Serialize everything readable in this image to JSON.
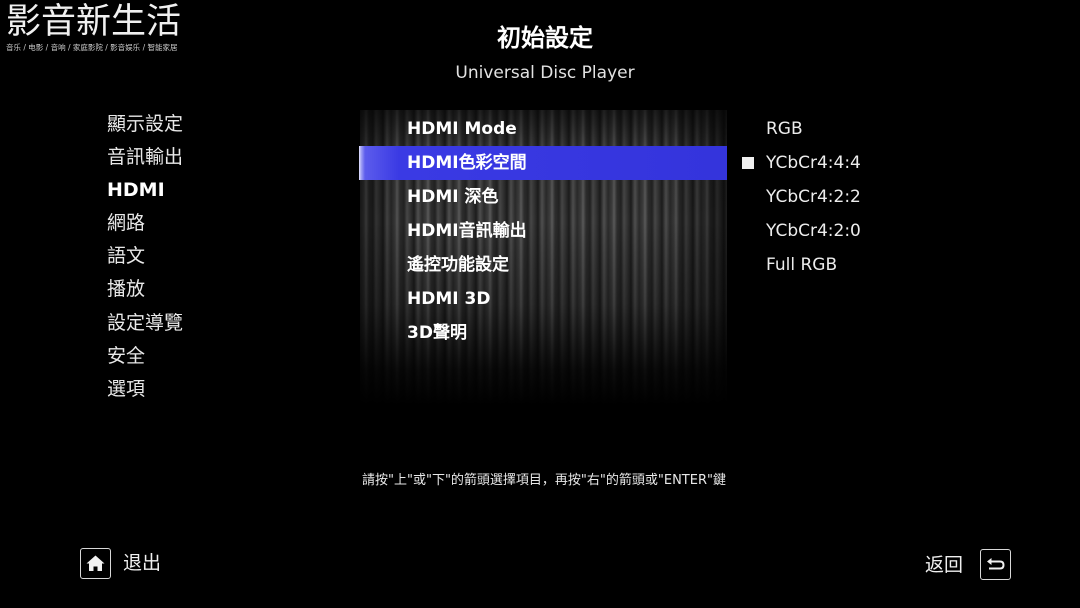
{
  "watermark": {
    "title": "影音新生活",
    "subtitle": "音乐 / 电影 / 音响 / 家庭影院 / 影音娱乐 / 智能家居"
  },
  "header": {
    "title": "初始設定",
    "subtitle": "Universal Disc Player"
  },
  "categories": [
    {
      "label": "顯示設定",
      "selected": false
    },
    {
      "label": "音訊輸出",
      "selected": false
    },
    {
      "label": "HDMI",
      "selected": true
    },
    {
      "label": "網路",
      "selected": false
    },
    {
      "label": "語文",
      "selected": false
    },
    {
      "label": "播放",
      "selected": false
    },
    {
      "label": "設定導覽",
      "selected": false
    },
    {
      "label": "安全",
      "selected": false
    },
    {
      "label": "選項",
      "selected": false
    }
  ],
  "settings": [
    {
      "label": "HDMI Mode",
      "highlighted": false
    },
    {
      "label": "HDMI色彩空間",
      "highlighted": true
    },
    {
      "label": "HDMI 深色",
      "highlighted": false
    },
    {
      "label": "HDMI音訊輸出",
      "highlighted": false
    },
    {
      "label": "遙控功能設定",
      "highlighted": false
    },
    {
      "label": "HDMI 3D",
      "highlighted": false
    },
    {
      "label": "3D聲明",
      "highlighted": false
    }
  ],
  "options": [
    {
      "label": "RGB",
      "checked": false
    },
    {
      "label": "YCbCr4:4:4",
      "checked": true
    },
    {
      "label": "YCbCr4:2:2",
      "checked": false
    },
    {
      "label": "YCbCr4:2:0",
      "checked": false
    },
    {
      "label": "Full RGB",
      "checked": false
    }
  ],
  "hint": "請按\"上\"或\"下\"的箭頭選擇項目，再按\"右\"的箭頭或\"ENTER\"鍵",
  "footer": {
    "exit": {
      "icon": "home-icon",
      "label": "退出"
    },
    "back": {
      "icon": "return-icon",
      "label": "返回"
    }
  },
  "colors": {
    "background": "#000000",
    "highlight": "#3a3ae4",
    "text": "#ffffff"
  }
}
